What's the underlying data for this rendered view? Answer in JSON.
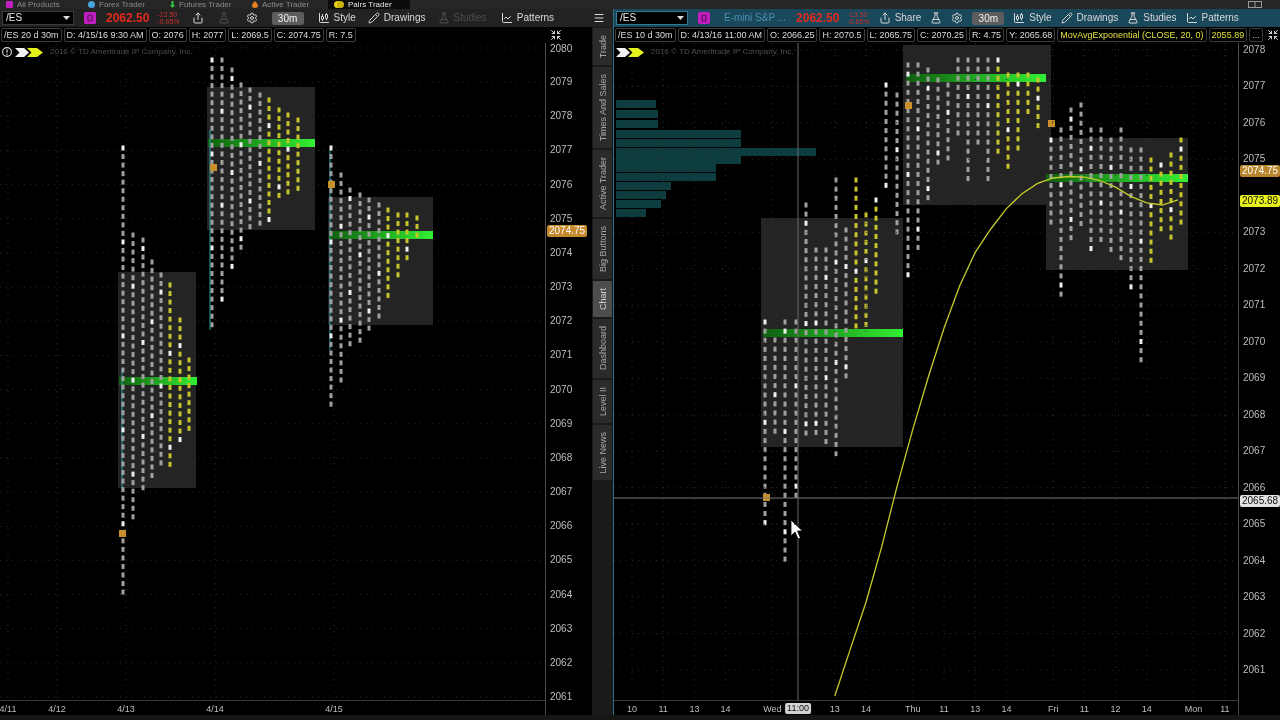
{
  "app_tabs": [
    {
      "label": "All Products",
      "selected": false
    },
    {
      "label": "Forex Trader",
      "selected": false
    },
    {
      "label": "Futures Trader",
      "selected": false
    },
    {
      "label": "Active Trader",
      "selected": false
    },
    {
      "label": "Pairs Trader",
      "selected": true
    }
  ],
  "left_chart": {
    "toolbar": {
      "symbol": "/ES",
      "price": "2062.50",
      "change": "-13.50",
      "change_percent": "-0.65%",
      "buttons": [
        {
          "kind": "share",
          "disabled": false
        },
        {
          "kind": "flask",
          "disabled": true
        },
        {
          "kind": "settings",
          "disabled": false
        },
        {
          "kind": "timeframe",
          "label": "30m",
          "disabled": false
        },
        {
          "kind": "style",
          "label": "Style",
          "disabled": false
        },
        {
          "kind": "drawings",
          "label": "Drawings",
          "disabled": false
        },
        {
          "kind": "studies",
          "label": "Studies",
          "disabled": true
        },
        {
          "kind": "patterns",
          "label": "Patterns",
          "disabled": false
        },
        {
          "kind": "menu",
          "disabled": false
        }
      ]
    },
    "info_cells": [
      {
        "kind": "plain",
        "text": "/ES 20 d 30m"
      },
      {
        "kind": "plain",
        "text": "D: 4/15/16 9:30 AM"
      },
      {
        "kind": "plain",
        "text": "O: 2076"
      },
      {
        "kind": "plain",
        "text": "H: 2077"
      },
      {
        "kind": "plain",
        "text": "L: 2069.5"
      },
      {
        "kind": "plain",
        "text": "C: 2074.75"
      },
      {
        "kind": "plain",
        "text": "R: 7.5"
      }
    ],
    "copyright": "2016 © TD Ameritrade IP Company, Inc.",
    "price_axis": {
      "labels": [
        "2080",
        "2079",
        "2078",
        "2077",
        "2076",
        "2075",
        "2074",
        "2073",
        "2072",
        "2071",
        "2070",
        "2069",
        "2068",
        "2067",
        "2066",
        "2065",
        "2064",
        "2063",
        "2062",
        "2061"
      ],
      "markers": [
        {
          "text": "2074.75",
          "color": "#c48a2c"
        }
      ]
    },
    "time_axis": {
      "labels": [
        "4/11",
        "4/12",
        "4/13",
        "4/14",
        "4/15"
      ]
    }
  },
  "side_tabs": [
    {
      "label": "Trade",
      "selected": false
    },
    {
      "label": "Times And Sales",
      "selected": false
    },
    {
      "label": "Active Trader",
      "selected": false
    },
    {
      "label": "Big Buttons",
      "selected": false
    },
    {
      "label": "Chart",
      "selected": true
    },
    {
      "label": "Dashboard",
      "selected": false
    },
    {
      "label": "Level II",
      "selected": false
    },
    {
      "label": "Live News",
      "selected": false
    }
  ],
  "right_chart": {
    "toolbar": {
      "symbol": "/ES",
      "description": "E-mini S&P ...",
      "price": "2062.50",
      "change": "-13.50",
      "change_percent": "-0.65%",
      "buttons": [
        {
          "kind": "share",
          "label": "Share",
          "disabled": false
        },
        {
          "kind": "flask",
          "disabled": false
        },
        {
          "kind": "settings",
          "disabled": false
        },
        {
          "kind": "timeframe",
          "label": "30m",
          "disabled": false
        },
        {
          "kind": "style",
          "label": "Style",
          "disabled": false
        },
        {
          "kind": "drawings",
          "label": "Drawings",
          "disabled": false
        },
        {
          "kind": "studies",
          "label": "Studies",
          "disabled": false
        },
        {
          "kind": "patterns",
          "label": "Patterns",
          "disabled": false
        }
      ]
    },
    "info_cells": [
      {
        "kind": "plain",
        "text": "/ES 10 d 30m"
      },
      {
        "kind": "plain",
        "text": "D: 4/13/16 11:00 AM"
      },
      {
        "kind": "plain",
        "text": "O: 2066.25"
      },
      {
        "kind": "plain",
        "text": "H: 2070.5"
      },
      {
        "kind": "plain",
        "text": "L: 2065.75"
      },
      {
        "kind": "plain",
        "text": "C: 2070.25"
      },
      {
        "kind": "plain",
        "text": "R: 4.75"
      },
      {
        "kind": "plain",
        "text": "Y: 2065.68"
      },
      {
        "kind": "study",
        "text": "MovAvgExponential (CLOSE, 20, 0)"
      },
      {
        "kind": "study",
        "text": "2055.89"
      },
      {
        "kind": "plain",
        "text": "..."
      }
    ],
    "copyright": "2016 © TD Ameritrade IP Company, Inc.",
    "chart_data": {
      "type": "line",
      "grid": true,
      "categories": [
        null,
        "10",
        null,
        "11",
        null,
        "13",
        null,
        "14",
        null,
        null,
        "Wed",
        null,
        null,
        null,
        "13",
        null,
        "14",
        null,
        null,
        "Thu",
        null,
        "11",
        null,
        "13",
        null,
        "14",
        null,
        null,
        "Fri",
        null,
        "11",
        null,
        "12",
        null,
        "14",
        null,
        null,
        "Mon",
        null,
        "11"
      ],
      "ylim": [
        2060.18,
        2078.19
      ],
      "yticks": [
        2078,
        2077,
        2076,
        2075,
        2073,
        2072,
        2071,
        2070,
        2069,
        2068,
        2067,
        2066,
        2065,
        2064,
        2063,
        2062,
        2061
      ],
      "series": [
        {
          "color": "#c5cc2a",
          "values": [
            null,
            null,
            null,
            null,
            null,
            null,
            null,
            null,
            null,
            null,
            null,
            null,
            null,
            null,
            2060.29,
            2061.58,
            2062.86,
            2064.37,
            2066.05,
            2067.6,
            2069.04,
            2070.37,
            2071.53,
            2072.45,
            2073.09,
            2073.65,
            2074.06,
            2074.34,
            2074.49,
            2074.53,
            2074.51,
            2074.42,
            2074.24,
            2073.98,
            2073.81,
            2073.75,
            2073.89,
            null,
            null,
            null
          ]
        }
      ]
    },
    "price_axis": {
      "markers": [
        {
          "text": "2074.75",
          "color": "#b8862c"
        },
        {
          "text": "2073.89",
          "color": "#e6f01a"
        },
        {
          "text": "2065.68",
          "color": "#e2e2e2"
        }
      ]
    },
    "time_axis": {
      "crosshair_label": "11:00"
    }
  }
}
